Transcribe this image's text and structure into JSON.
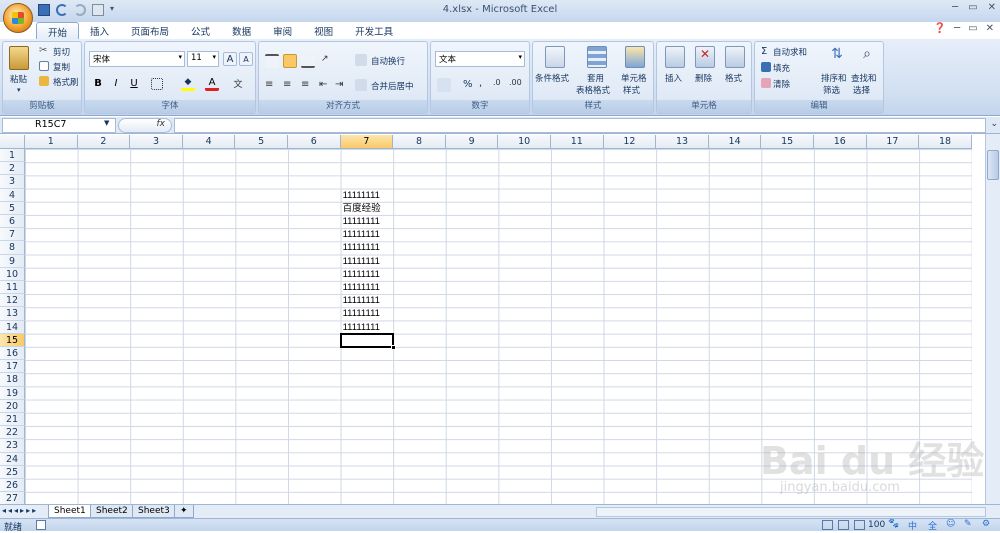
{
  "window": {
    "title": "4.xlsx - Microsoft Excel",
    "minimize": "─",
    "maximize": "▭",
    "close": "✕"
  },
  "tabs": [
    "开始",
    "插入",
    "页面布局",
    "公式",
    "数据",
    "审阅",
    "视图",
    "开发工具"
  ],
  "ribbon": {
    "clipboard": {
      "label": "剪贴板",
      "paste": "粘贴",
      "cut": "剪切",
      "copy": "复制",
      "format_painter": "格式刷"
    },
    "font": {
      "label": "字体",
      "name": "宋体",
      "size": "11",
      "bold": "B",
      "italic": "I",
      "underline": "U"
    },
    "alignment": {
      "label": "对齐方式",
      "wrap": "自动换行",
      "merge": "合并后居中"
    },
    "number": {
      "label": "数字",
      "format": "文本",
      "percent": "%"
    },
    "styles": {
      "label": "样式",
      "conditional": "条件格式",
      "table_line1": "套用",
      "table_line2": "表格格式",
      "cell_styles_line1": "单元格",
      "cell_styles_line2": "样式"
    },
    "cells": {
      "label": "单元格",
      "insert": "插入",
      "delete": "删除",
      "format": "格式"
    },
    "editing": {
      "label": "编辑",
      "autosum": "自动求和",
      "fill": "填充",
      "clear": "清除",
      "sort_line1": "排序和",
      "sort_line2": "筛选",
      "find_line1": "查找和",
      "find_line2": "选择"
    }
  },
  "formula_bar": {
    "name_box": "R15C7",
    "fx": "fx",
    "value": ""
  },
  "columns": [
    "1",
    "2",
    "3",
    "4",
    "5",
    "6",
    "7",
    "8",
    "9",
    "10",
    "11",
    "12",
    "13",
    "14",
    "15",
    "16",
    "17",
    "18"
  ],
  "rows": [
    "1",
    "2",
    "3",
    "4",
    "5",
    "6",
    "7",
    "8",
    "9",
    "10",
    "11",
    "12",
    "13",
    "14",
    "15",
    "16",
    "17",
    "18",
    "19",
    "20",
    "21",
    "22",
    "23",
    "24",
    "25",
    "26",
    "27"
  ],
  "selected": {
    "row": "15",
    "col": "7"
  },
  "cells": [
    {
      "row": 4,
      "col": 7,
      "value": "11111111"
    },
    {
      "row": 5,
      "col": 7,
      "value": "百度经验"
    },
    {
      "row": 6,
      "col": 7,
      "value": "11111111"
    },
    {
      "row": 7,
      "col": 7,
      "value": "11111111"
    },
    {
      "row": 8,
      "col": 7,
      "value": "11111111"
    },
    {
      "row": 9,
      "col": 7,
      "value": "11111111"
    },
    {
      "row": 10,
      "col": 7,
      "value": "11111111"
    },
    {
      "row": 11,
      "col": 7,
      "value": "11111111"
    },
    {
      "row": 12,
      "col": 7,
      "value": "11111111"
    },
    {
      "row": 13,
      "col": 7,
      "value": "11111111"
    },
    {
      "row": 14,
      "col": 7,
      "value": "11111111"
    }
  ],
  "sheets": [
    "Sheet1",
    "Sheet2",
    "Sheet3"
  ],
  "status": {
    "ready": "就绪",
    "zoom": "100"
  },
  "watermark": {
    "main": "Bai du 经验",
    "sub": "jingyan.baidu.com"
  },
  "ime": [
    "中",
    "全"
  ]
}
